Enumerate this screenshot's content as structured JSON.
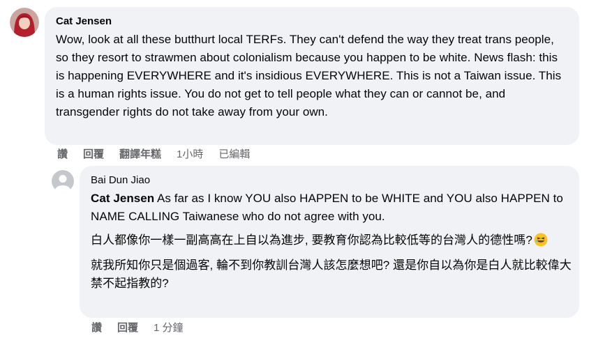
{
  "comments": [
    {
      "author": "Cat Jensen",
      "text": "Wow, look at all these butthurt local TERFs. They can't defend the way they treat trans people, so they resort to strawmen about colonialism because you happen to be white. News flash: this is happening EVERYWHERE and it's insidious EVERYWHERE. This is not a Taiwan issue. This is a human rights issue. You do not get to tell people what they can or cannot be, and transgender rights do not take away from your own.",
      "actions": {
        "like": "讚",
        "reply": "回覆",
        "translate": "翻譯年糕",
        "time": "1小時",
        "edited": "已編輯"
      }
    }
  ],
  "reply": {
    "author": "Bai Dun Jiao",
    "mention": "Cat Jensen",
    "line1_rest": " As far as I know YOU also HAPPEN to be WHITE and YOU also HAPPEN to NAME CALLING Taiwanese who do not agree with you.",
    "paragraph2": "白人都像你一樣一副高高在上自以為進步, 要教育你認為比較低等的台灣人的德性嗎?",
    "paragraph3": "就我所知你只是個過客, 輪不到你教訓台灣人該怎麼想吧? 還是你自以為你是白人就比較偉大禁不起指教的?",
    "actions": {
      "like": "讚",
      "reply": "回覆",
      "time": "1 分鐘"
    }
  },
  "colors": {
    "bubble": "#f0f2f5",
    "text": "#050505",
    "secondary": "#65676b"
  }
}
